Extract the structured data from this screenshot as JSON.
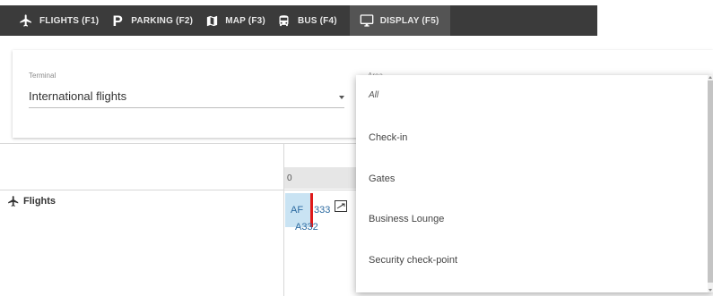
{
  "toolbar": {
    "items": [
      {
        "label": "FLIGHTS (F1)",
        "icon": "airplane-icon"
      },
      {
        "label": "PARKING (F2)",
        "icon": "parking-p-icon",
        "glyph": "P"
      },
      {
        "label": "MAP (F3)",
        "icon": "map-icon"
      },
      {
        "label": "BUS (F4)",
        "icon": "bus-icon"
      },
      {
        "label": "DISPLAY (F5)",
        "icon": "monitor-icon",
        "active": true
      }
    ],
    "background": "#3b3b3b",
    "active_background": "#545454"
  },
  "filters": {
    "terminal": {
      "label": "Terminal",
      "value": "International flights"
    },
    "area": {
      "label": "Area"
    }
  },
  "grid": {
    "tick_label": "0",
    "rows": [
      {
        "label": "Flights",
        "icon": "airplane-icon"
      }
    ],
    "flight": {
      "airline": "AF",
      "number": "333",
      "aircraft": "A332",
      "status_color": "#e01919",
      "block_color": "#c9e3f3",
      "icon": "arrival-icon"
    }
  },
  "dropdown": {
    "options": [
      "All",
      "Check-in",
      "Gates",
      "Business Lounge",
      "Security check-point"
    ]
  }
}
